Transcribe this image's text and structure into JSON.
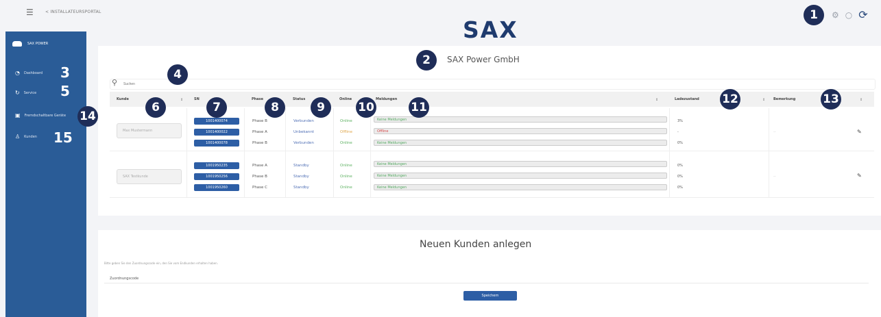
{
  "topbar": {
    "menu_icon": "hamburger-icon",
    "back_label": "< INSTALLATEURSPORTAL",
    "logo_text": "SAX",
    "icons": [
      "gear-icon",
      "circle-icon",
      "sync-icon"
    ]
  },
  "sidebar": {
    "brand": "SAX POWER",
    "items": [
      {
        "label": "Dashboard",
        "icon": "dashboard-icon"
      },
      {
        "label": "Service",
        "icon": "refresh-icon"
      },
      {
        "label": "Fremdschaltbare Geräte",
        "icon": "device-icon"
      },
      {
        "label": "Kunden",
        "icon": "user-icon"
      }
    ]
  },
  "annotations": [
    "1",
    "2",
    "3",
    "4",
    "5",
    "6",
    "7",
    "8",
    "9",
    "10",
    "11",
    "12",
    "13",
    "14",
    "15"
  ],
  "main": {
    "company": "SAX Power GmbH",
    "search_placeholder": "Suchen",
    "columns": {
      "kunde": "Kunde",
      "sn": "SN",
      "phase": "Phase",
      "status": "Status",
      "online": "Online",
      "meldungen": "Meldungen",
      "ladezustand": "Ladezustand",
      "bemerkung": "Bemerkung"
    },
    "customers": [
      {
        "name": "Max Mustermann",
        "units": [
          {
            "sn": "1001400074",
            "phase": "Phase B",
            "status": "Verbunden",
            "online": "Online",
            "message": "Keine Meldungen",
            "charge": "3%"
          },
          {
            "sn": "1001400022",
            "phase": "Phase A",
            "status": "Unbekannt",
            "online": "Offline",
            "message": "Offline",
            "charge": "-"
          },
          {
            "sn": "1001400078",
            "phase": "Phase B",
            "status": "Verbunden",
            "online": "Online",
            "message": "Keine Meldungen",
            "charge": "0%"
          }
        ],
        "remark": "--"
      },
      {
        "name": "SAX Testkunde",
        "units": [
          {
            "sn": "1001950235",
            "phase": "Phase A",
            "status": "Standby",
            "online": "Online",
            "message": "Keine Meldungen",
            "charge": "0%"
          },
          {
            "sn": "1001950256",
            "phase": "Phase B",
            "status": "Standby",
            "online": "Online",
            "message": "Keine Meldungen",
            "charge": "0%"
          },
          {
            "sn": "1001950260",
            "phase": "Phase C",
            "status": "Standby",
            "online": "Online",
            "message": "Keine Meldungen",
            "charge": "0%"
          }
        ],
        "remark": "--"
      }
    ]
  },
  "new_customer": {
    "title": "Neuen Kunden anlegen",
    "hint": "Bitte geben Sie den Zuordnungscode ein, den Sie vom Endkunden erhalten haben.",
    "field_label": "Zuordnungscode",
    "save_label": "Speichern"
  },
  "colors": {
    "sidebar": "#2a5c97",
    "badge": "#1f2d58",
    "sn_button": "#2d5ea5",
    "online": "#5bb05f",
    "offline": "#e0a74a"
  }
}
